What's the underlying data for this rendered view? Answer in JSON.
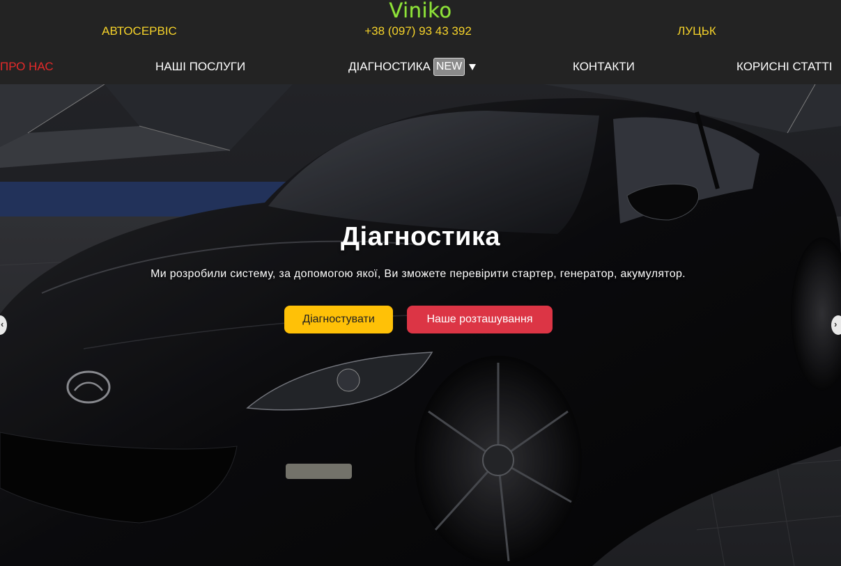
{
  "brand": {
    "logo": "Viniko",
    "logo_color": "#8fe23a"
  },
  "info": {
    "service": "АВТОСЕРВІС",
    "phone": "+38 (097) 93 43 392",
    "city": "ЛУЦЬК"
  },
  "nav": {
    "about": "ПРО НАС",
    "services": "НАШІ ПОСЛУГИ",
    "diagnostics": "ДІАГНОСТИКА",
    "diagnostics_badge": "NEW",
    "contacts": "КОНТАКТИ",
    "articles": "КОРИСНІ СТАТТІ"
  },
  "hero": {
    "title": "Діагностика",
    "text": "Ми розробили систему, за допомогою якої, Ви зможете перевірити стартер, генератор, акумулятор.",
    "btn_primary": "Діагностувати",
    "btn_secondary": "Наше розташування"
  },
  "icons": {
    "dropdown": "caret-down-icon",
    "prev": "chevron-left-icon",
    "next": "chevron-right-icon"
  },
  "colors": {
    "header_bg": "#232323",
    "info_text": "#f6d32a",
    "active_nav": "#e52a2a",
    "primary_button": "#ffc107",
    "secondary_button": "#dc3545"
  }
}
